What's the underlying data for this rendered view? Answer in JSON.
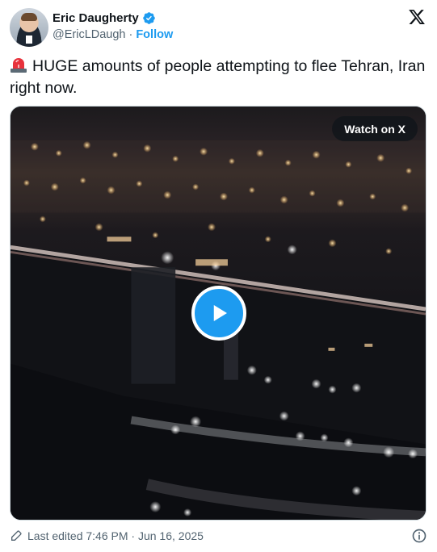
{
  "author": {
    "display_name": "Eric Daugherty",
    "handle": "@EricLDaugh",
    "separator": "·",
    "follow_label": "Follow"
  },
  "icons": {
    "verified": "verified-badge-icon",
    "brand": "x-logo-icon",
    "siren": "siren-emoji-icon",
    "play": "play-icon",
    "edit": "pencil-icon",
    "info": "info-icon"
  },
  "tweet": {
    "text": "HUGE amounts of people attempting to flee Tehran, Iran right now."
  },
  "media": {
    "watch_label": "Watch on X"
  },
  "footer": {
    "edited_text": "Last edited 7:46 PM · Jun 16, 2025"
  },
  "colors": {
    "accent": "#1d9bf0",
    "text": "#0f1419",
    "muted": "#536471"
  }
}
